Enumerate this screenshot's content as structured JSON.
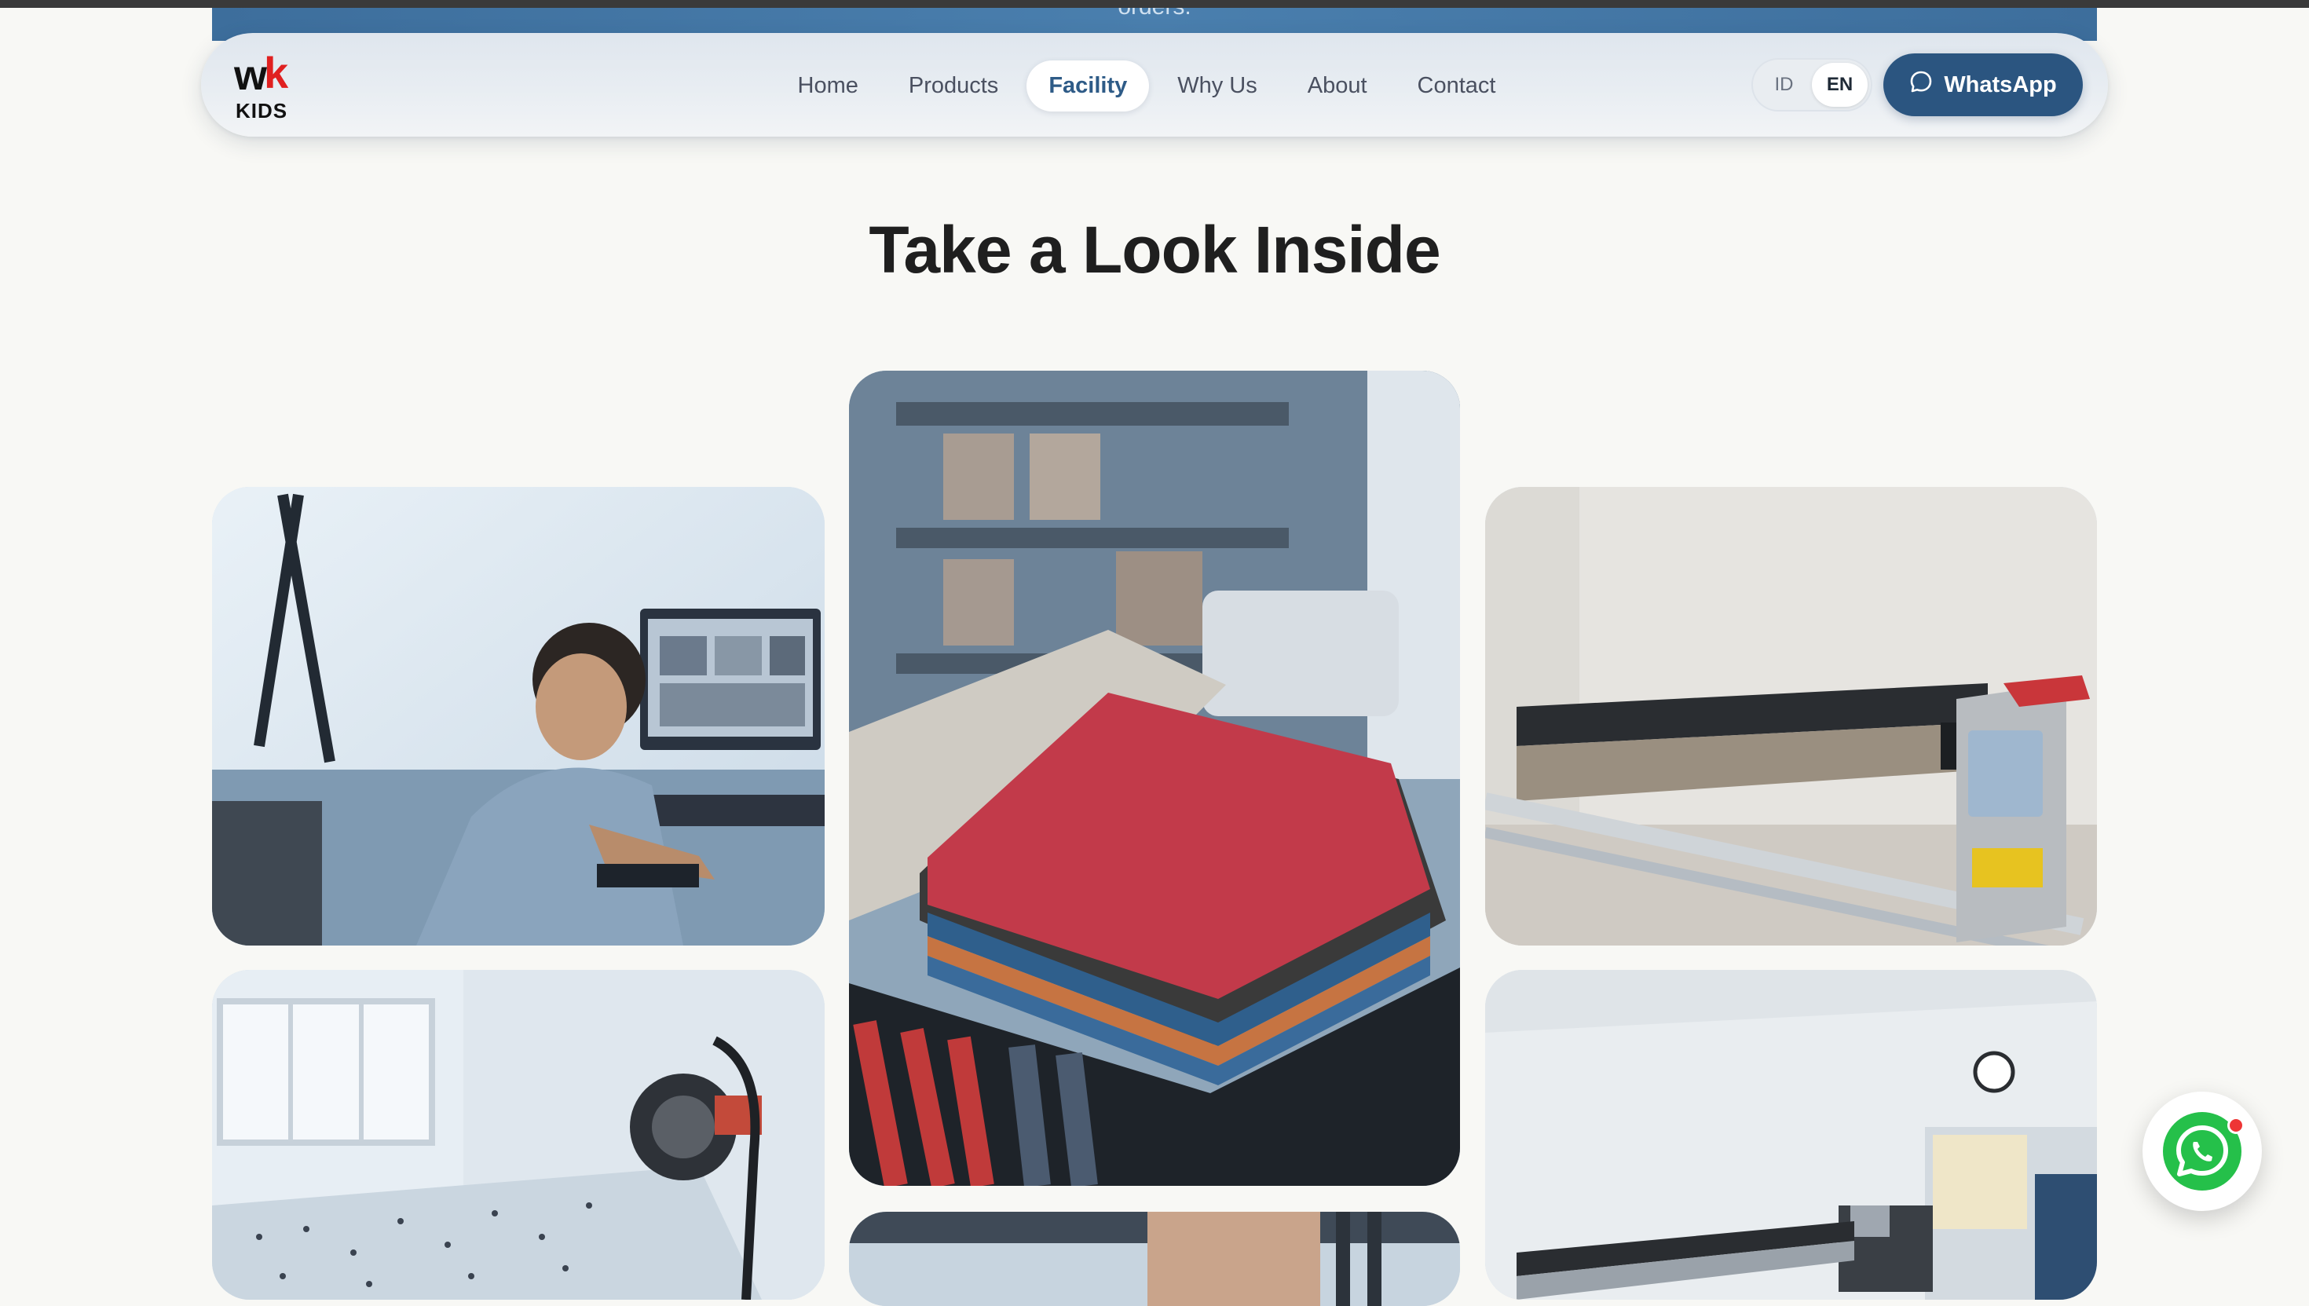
{
  "hero": {
    "sliver_text": "orders."
  },
  "brand": {
    "logo_top": "wk",
    "logo_bottom": "KIDS"
  },
  "nav": {
    "items": [
      {
        "label": "Home",
        "active": false
      },
      {
        "label": "Products",
        "active": false
      },
      {
        "label": "Facility",
        "active": true
      },
      {
        "label": "Why Us",
        "active": false
      },
      {
        "label": "About",
        "active": false
      },
      {
        "label": "Contact",
        "active": false
      }
    ]
  },
  "language": {
    "options": [
      "ID",
      "EN"
    ],
    "selected": "EN"
  },
  "whatsapp": {
    "label": "WhatsApp"
  },
  "section": {
    "title": "Take a Look Inside"
  },
  "gallery": {
    "photos": [
      {
        "name": "photo-designer-at-computer"
      },
      {
        "name": "photo-folded-tshirts"
      },
      {
        "name": "photo-plotter-machine"
      },
      {
        "name": "photo-cutting-table"
      },
      {
        "name": "photo-sewing-area"
      },
      {
        "name": "photo-plotter-room"
      }
    ]
  },
  "colors": {
    "accent": "#2b5580",
    "whatsapp_green": "#25c04a",
    "notification_red": "#ee3535"
  }
}
